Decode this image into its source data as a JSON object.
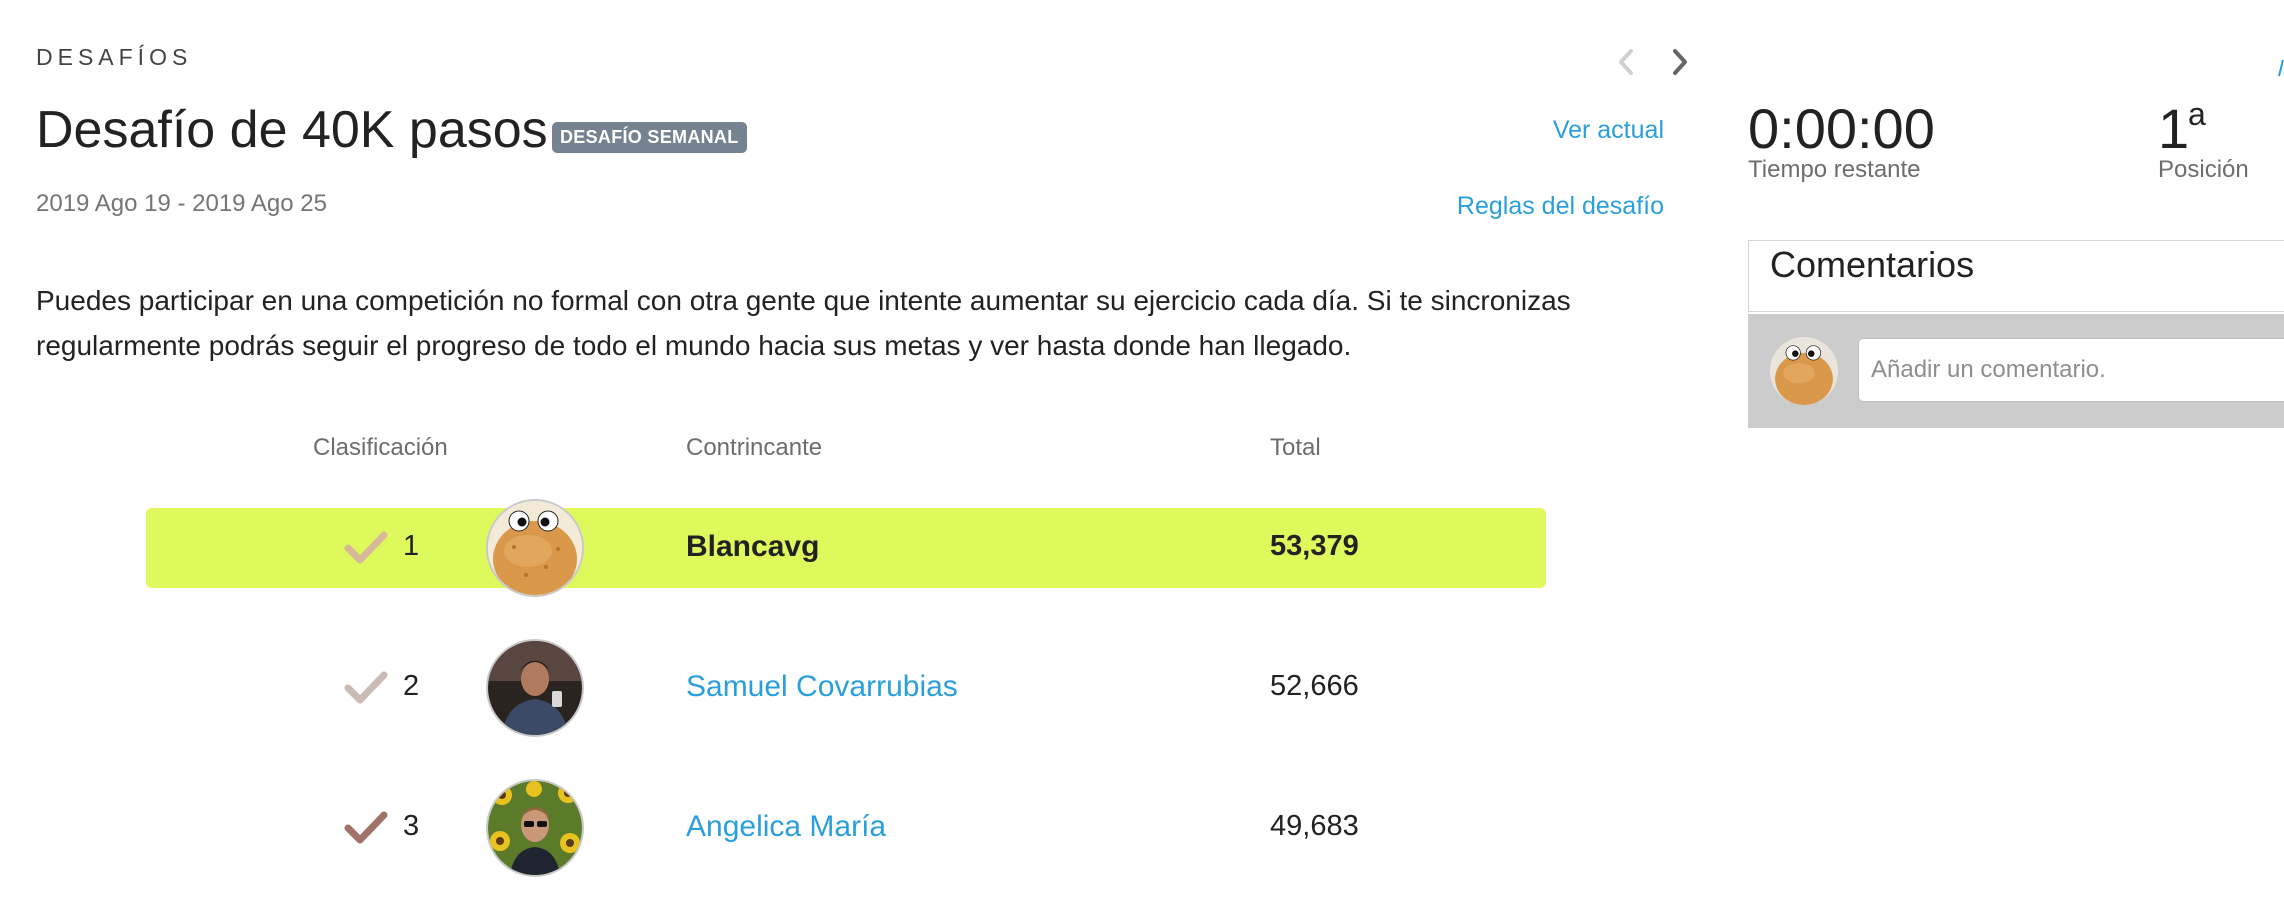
{
  "header": {
    "section_label": "DESAFÍOS",
    "title": "Desafío de 40K pasos",
    "badge": "DESAFÍO SEMANAL",
    "dates": "2019 Ago 19 - 2019 Ago 25",
    "link_current": "Ver actual",
    "link_rules": "Reglas del desafío"
  },
  "description": "Puedes participar en una competición no formal con otra gente que intente aumentar su ejercicio cada día. Si te sincronizas regularmente podrás seguir el progreso de todo el mundo hacia sus metas y ver hasta donde han llegado.",
  "leaderboard": {
    "columns": {
      "rank": "Clasificación",
      "opponent": "Contrincante",
      "total": "Total"
    },
    "rows": [
      {
        "rank": "1",
        "name": "Blancavg",
        "total": "53,379",
        "highlighted": true,
        "check_color": "#d7b99a",
        "avatar": "cookie-avatar"
      },
      {
        "rank": "2",
        "name": "Samuel Covarrubias",
        "total": "52,666",
        "highlighted": false,
        "check_color": "#c8bcb4",
        "avatar": "man-photo-avatar"
      },
      {
        "rank": "3",
        "name": "Angelica María",
        "total": "49,683",
        "highlighted": false,
        "check_color": "#a0726a",
        "avatar": "sunflower-photo-avatar"
      }
    ]
  },
  "stats": {
    "time_value": "0:00:00",
    "time_label": "Tiempo restante",
    "position_value": "1",
    "position_suffix": "a",
    "position_label": "Posición"
  },
  "comments": {
    "title": "Comentarios",
    "placeholder": "Añadir un comentario."
  },
  "colors": {
    "accent_link": "#2a9fdb",
    "highlight_row": "#def95c",
    "badge_bg": "#758290",
    "comment_bar_bg": "#cccccc"
  },
  "icons": [
    "chevron-left-icon",
    "chevron-right-icon",
    "check-icon"
  ]
}
